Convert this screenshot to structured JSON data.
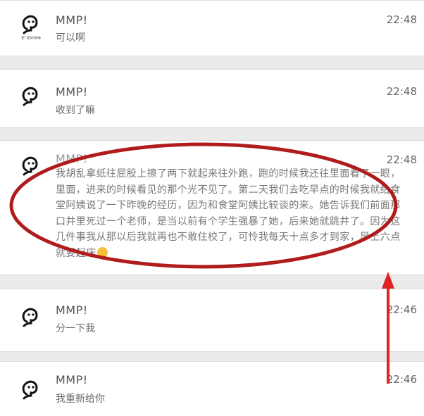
{
  "chats": [
    {
      "name": "MMP!",
      "time": "22:48",
      "message": "可以啊"
    },
    {
      "name": "MMP!",
      "time": "22:48",
      "message": "收到了嘛"
    },
    {
      "name": "MMP!",
      "time": "22:48",
      "message": "我胡乱拿纸往屁股上擦了两下就起来往外跑，跑的时候我还往里面看了一眼，里面，进来的时候看见的那个光不见了。第二天我们去吃早点的时候我就给食堂阿姨说了一下昨晚的经历，因为和食堂阿姨比较谈的来。她告诉我们前面那口井里死过一个老师，是当以前有个学生强暴了她，后来她就跳井了。因为这几件事我从那以后我就再也不敢住校了，可怜我每天十点多才到家，早上六点就要起床"
    },
    {
      "name": "MMP!",
      "time": "22:46",
      "message": "分一下我"
    },
    {
      "name": "MMP!",
      "time": "22:46",
      "message": "我重新给你"
    }
  ],
  "avatar_caption": "是? 我没你很嗨",
  "annotation_colors": {
    "ellipse": "#b01c1c",
    "arrow": "#e02424"
  }
}
